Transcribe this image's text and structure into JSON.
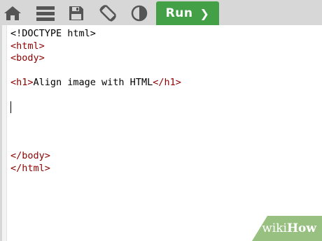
{
  "toolbar": {
    "icons": [
      "home-icon",
      "menu-icon",
      "save-icon",
      "rotate-icon",
      "contrast-icon"
    ],
    "run_label": "Run",
    "run_chevron": "❯",
    "accent_color": "#43a047"
  },
  "editor": {
    "lines": [
      [
        {
          "t": "<!DOCTYPE html>",
          "c": "plain"
        }
      ],
      [
        {
          "t": "<html>",
          "c": "tag"
        }
      ],
      [
        {
          "t": "<body>",
          "c": "tag"
        }
      ],
      [],
      [
        {
          "t": "<h1>",
          "c": "tag"
        },
        {
          "t": "Align image with HTML",
          "c": "plain"
        },
        {
          "t": "</h1>",
          "c": "tag"
        }
      ],
      [],
      [
        {
          "t": "|caret|",
          "c": "caret"
        }
      ],
      [],
      [],
      [],
      [
        {
          "t": "</body>",
          "c": "tag"
        }
      ],
      [
        {
          "t": "</html>",
          "c": "tag"
        }
      ]
    ]
  },
  "watermark": {
    "prefix": "wiki",
    "suffix": "How"
  }
}
